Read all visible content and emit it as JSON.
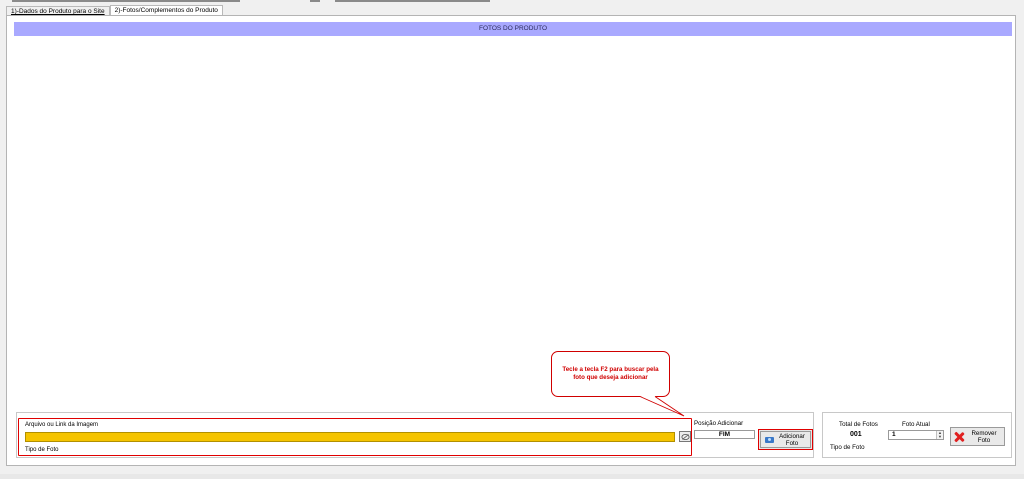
{
  "tabs": [
    {
      "label": "1)-Dados do Produto para o Site",
      "active": false
    },
    {
      "label": "2)-Fotos/Complementos do Produto",
      "active": true
    }
  ],
  "header": {
    "title": "FOTOS DO PRODUTO"
  },
  "arquivo": {
    "label": "Arquivo ou Link da Imagem",
    "value": "",
    "tipo_foto_label": "Tipo de Foto"
  },
  "posicao": {
    "label": "Posição Adicionar",
    "value": "FIM"
  },
  "adicionar": {
    "line1": "Adicionar",
    "line2": "Foto"
  },
  "totais": {
    "total_label": "Total de Fotos",
    "total_value": "001",
    "tipo_foto_label": "Tipo de Foto",
    "atual_label": "Foto Atual",
    "atual_value": "1"
  },
  "remover": {
    "line1": "Remover",
    "line2": "Foto"
  },
  "callout": {
    "line1": "Tecle a tecla F2 para buscar pela",
    "line2": "foto que deseja adicionar"
  },
  "colors": {
    "header_bg": "#a9a9ff",
    "input_highlight": "#f5c400",
    "callout_red": "#d00000"
  },
  "icons": {
    "browse": "browse-icon",
    "camera": "camera-icon",
    "remove": "red-x-icon"
  }
}
